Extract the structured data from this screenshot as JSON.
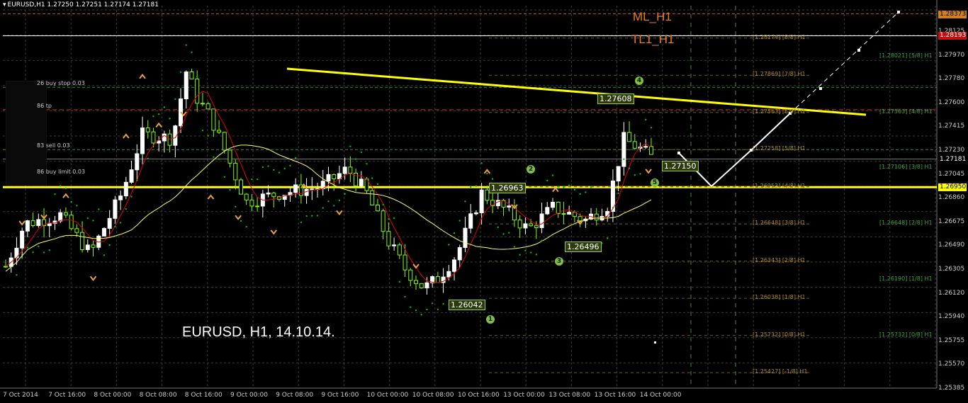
{
  "header": {
    "symbol_line": "EURUSD,H1  1.27250 1.27251 1.27174 1.27181"
  },
  "title_overlay": "EURUSD, H1, 14.10.14.",
  "indicator_labels": {
    "ml": "ML_H1",
    "tl": "TL1_H1"
  },
  "order_labels": [
    {
      "text": "26 buy stop 0.03",
      "price": 1.2777
    },
    {
      "text": "86 tp",
      "price": 1.27586
    },
    {
      "text": "83 sell 0.03",
      "price": 1.27258
    },
    {
      "text": "86 buy limit 0.03",
      "price": 1.27045
    }
  ],
  "price_axis": {
    "ticks": [
      "1.28125",
      "1.27970",
      "1.27780",
      "1.27600",
      "1.27415",
      "1.27230",
      "1.27045",
      "1.26860",
      "1.26675",
      "1.26490",
      "1.26305",
      "1.26120",
      "1.25940",
      "1.25755",
      "1.25570",
      "1.25385"
    ],
    "tag_top": "1.28373",
    "tag_red": "1.28193",
    "tag_current": "1.27181",
    "tag_yellow": "1.26950"
  },
  "time_axis": [
    "7 Oct 2014",
    "7 Oct 16:00",
    "8 Oct 00:00",
    "8 Oct 08:00",
    "8 Oct 16:00",
    "9 Oct 00:00",
    "9 Oct 08:00",
    "9 Oct 16:00",
    "10 Oct 00:00",
    "10 Oct 08:00",
    "10 Oct 16:00",
    "13 Oct 00:00",
    "13 Oct 08:00",
    "13 Oct 16:00",
    "14 Oct 00:00"
  ],
  "murrey_left": [
    {
      "text": "[1.28174] [8/8] H1",
      "price": 1.28174
    },
    {
      "text": "[1.27869] [7/8] H1",
      "price": 1.27869
    },
    {
      "text": "[1.27563] [6/8] H1",
      "price": 1.27563
    },
    {
      "text": "[1.27258] [5/8] H1",
      "price": 1.27258
    },
    {
      "text": "[1.26953] [4/8] H1",
      "price": 1.26953
    },
    {
      "text": "[1.26648] [3/8] H1",
      "price": 1.26648
    },
    {
      "text": "[1.26343] [2/8] H1",
      "price": 1.26343
    },
    {
      "text": "[1.26038] [1/8] H1",
      "price": 1.26038
    },
    {
      "text": "[1.25732] [0/8] H1",
      "price": 1.25732
    },
    {
      "text": "[1.25427] [-1/8] H1",
      "price": 1.25427
    }
  ],
  "murrey_right": [
    {
      "text": "[1.28021] [5/8] H1",
      "price": 1.28021
    },
    {
      "text": "[1.27563] [4/8] H1",
      "price": 1.27563
    },
    {
      "text": "[1.27106] [3/8] H1",
      "price": 1.27106
    },
    {
      "text": "[1.26648] [2/8] H1",
      "price": 1.26648
    },
    {
      "text": "[1.26190] [1/8] H1",
      "price": 1.2619
    },
    {
      "text": "[1.25732] [0/8] H1",
      "price": 1.25732
    }
  ],
  "price_boxes": [
    {
      "text": "1.27608",
      "price": 1.2765
    },
    {
      "text": "1.26963",
      "price": 1.26963
    },
    {
      "text": "1.26496",
      "price": 1.26496
    },
    {
      "text": "1.26042",
      "price": 1.26042
    },
    {
      "text": "1.27150",
      "price": 1.2715
    }
  ],
  "wave_marks": [
    "1",
    "2",
    "3",
    "4",
    "5"
  ],
  "colors": {
    "background": "#000000",
    "bull_candle": "#ffffff",
    "bear_candle": "#7fff00",
    "trendline": "#ffff00",
    "ma_fast": "#e00000",
    "ma_slow": "#ffff66",
    "parabolic_sar": "#00c000",
    "fractal": "#e8a040",
    "projection": "#ffffff"
  },
  "chart_data": {
    "type": "candlestick",
    "symbol": "EURUSD",
    "timeframe": "H1",
    "ylim": [
      1.253,
      1.2844
    ],
    "swing_points": [
      {
        "label": "1",
        "price": 1.26042
      },
      {
        "label": "2",
        "price": 1.26963
      },
      {
        "label": "3",
        "price": 1.26496
      },
      {
        "label": "4",
        "price": 1.27608
      },
      {
        "label": "5",
        "price": 1.2715
      }
    ],
    "horizontal_levels": [
      1.28373,
      1.28193,
      1.2695,
      1.27181
    ],
    "projection_path": [
      1.2723,
      1.2695,
      1.27258,
      1.27563,
      1.2777,
      1.28021,
      1.28373
    ]
  }
}
